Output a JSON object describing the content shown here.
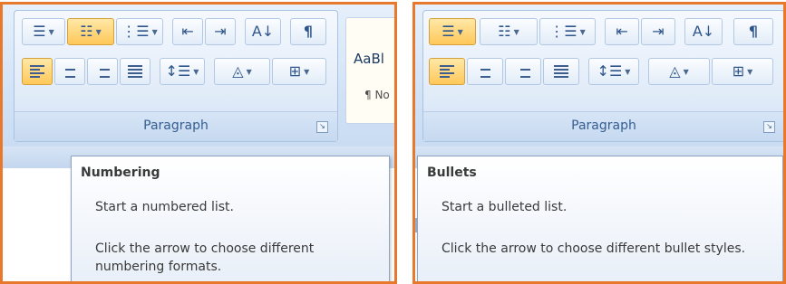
{
  "panels": [
    {
      "id": "left",
      "group_label": "Paragraph",
      "styles_gallery": {
        "preview_text": "AaBl",
        "style_name": "¶ No"
      },
      "tooltip": {
        "title": "Numbering",
        "description": "Start a numbered list.",
        "more": "Click the arrow to choose different numbering formats."
      },
      "active_button": "numbering-button"
    },
    {
      "id": "right",
      "group_label": "Paragraph",
      "tooltip": {
        "title": "Bullets",
        "description": "Start a bulleted list.",
        "more": "Click the arrow to choose different bullet styles."
      },
      "active_button": "bullets-button"
    }
  ],
  "toolbar_row1": [
    "bullets-icon",
    "numbering-icon",
    "multilevel-list-icon",
    "decrease-indent-icon",
    "increase-indent-icon",
    "sort-icon",
    "show-formatting-marks-icon"
  ],
  "toolbar_row2": [
    "align-left-icon",
    "center-icon",
    "align-right-icon",
    "justify-icon",
    "line-spacing-icon",
    "shading-icon",
    "borders-icon"
  ],
  "glyphs": {
    "sort": "A↓",
    "pilcrow": "¶",
    "launcher": "↘",
    "dropdown": "▼"
  },
  "colors": {
    "highlight_border": "#e8782c",
    "active_button": "#ffc85a",
    "ribbon": "#d3e3f6"
  }
}
